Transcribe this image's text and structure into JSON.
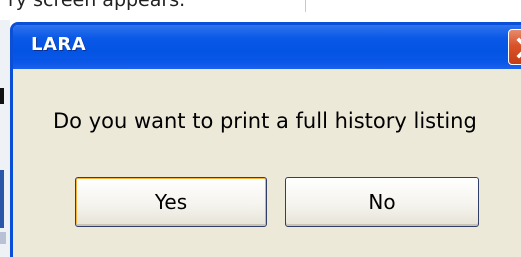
{
  "background": {
    "caption": "ry screen appears."
  },
  "dialog": {
    "title": "LARA",
    "message": "Do you want to print a full history listing",
    "buttons": {
      "yes_label": "Yes",
      "no_label": "No"
    },
    "close_icon": "close-icon"
  },
  "colors": {
    "titlebar": "#0a58e6",
    "dialog_bg": "#ece9d8",
    "close_button": "#d9532a"
  }
}
